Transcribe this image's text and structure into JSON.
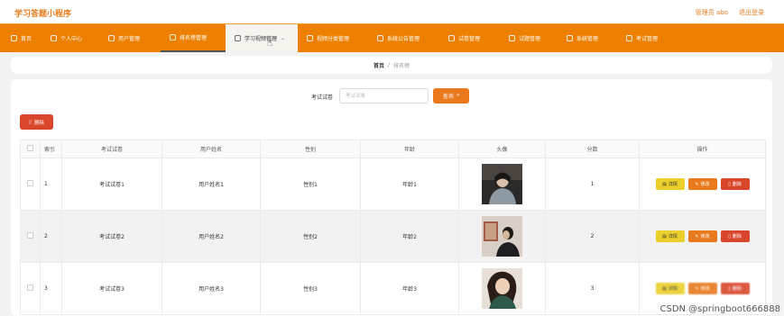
{
  "header": {
    "title": "学习答题小程序",
    "user": "管理员 abo",
    "logout": "退出登录"
  },
  "nav": {
    "items": [
      {
        "label": "首页",
        "icon": "home-icon"
      },
      {
        "label": "个人中心",
        "icon": "user-icon"
      },
      {
        "label": "用户管理",
        "icon": "users-icon"
      },
      {
        "label": "排名榜管理",
        "icon": "ranking-icon"
      },
      {
        "label": "学习视频管理",
        "icon": "video-icon"
      },
      {
        "label": "视频分类管理",
        "icon": "category-icon"
      },
      {
        "label": "系统公告管理",
        "icon": "notice-icon"
      },
      {
        "label": "试卷管理",
        "icon": "paper-icon"
      },
      {
        "label": "试题管理",
        "icon": "question-icon"
      },
      {
        "label": "系统管理",
        "icon": "system-icon"
      },
      {
        "label": "考试管理",
        "icon": "exam-icon"
      }
    ]
  },
  "breadcrumb": {
    "home": "首页",
    "sep": "/",
    "current": "排名榜"
  },
  "search": {
    "label": "考试试卷",
    "placeholder": "考试试卷",
    "button": "查询"
  },
  "toolbar": {
    "delete": "删除"
  },
  "table": {
    "columns": [
      "",
      "索引",
      "考试试卷",
      "用户姓名",
      "性别",
      "年龄",
      "头像",
      "分数",
      "操作"
    ],
    "rows": [
      {
        "index": "1",
        "paper": "考试试卷1",
        "name": "用户姓名1",
        "gender": "性别1",
        "age": "年龄1",
        "score": "1"
      },
      {
        "index": "2",
        "paper": "考试试卷2",
        "name": "用户姓名2",
        "gender": "性别2",
        "age": "年龄2",
        "score": "2"
      },
      {
        "index": "3",
        "paper": "考试试卷3",
        "name": "用户姓名3",
        "gender": "性别3",
        "age": "年龄3",
        "score": "3"
      }
    ],
    "actions": {
      "detail": "详情",
      "edit": "修改",
      "delete": "删除"
    }
  },
  "watermark": "CSDN @springboot666888",
  "colors": {
    "brand": "#e67e22",
    "nav": "#ed8000",
    "search_button": "#e8791d",
    "detail": "#eccf2a",
    "edit": "#e8791d",
    "delete": "#d9462b"
  }
}
